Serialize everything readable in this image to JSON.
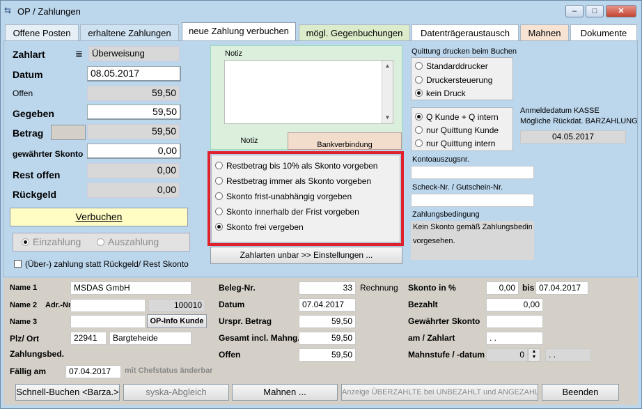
{
  "window": {
    "title": "OP / Zahlungen",
    "min": "–",
    "max": "□",
    "close": "✕"
  },
  "tabs": [
    "Offene Posten",
    "erhaltene Zahlungen",
    "neue Zahlung verbuchen",
    "mögl. Gegenbuchungen",
    "Datenträgeraustausch",
    "Mahnen",
    "Dokumente"
  ],
  "left": {
    "zahlart_label": "Zahlart",
    "zahlart_value": "Überweisung",
    "datum_label": "Datum",
    "datum_value": "08.05.2017",
    "offen_label": "Offen",
    "offen_value": "59,50",
    "gegeben_label": "Gegeben",
    "gegeben_value": "59,50",
    "betrag_label": "Betrag",
    "betrag_value": "59,50",
    "skonto_label": "gewährter Skonto",
    "skonto_value": "0,00",
    "rest_label": "Rest offen",
    "rest_value": "0,00",
    "rueckgeld_label": "Rückgeld",
    "rueckgeld_value": "0,00",
    "verbuchen": "Verbuchen",
    "einzahlung": "Einzahlung",
    "auszahlung": "Auszahlung",
    "ueberzahlung": "(Über-) zahlung statt Rückgeld/ Rest Skonto"
  },
  "notiz": {
    "label": "Notiz",
    "tab_notiz": "Notiz",
    "tab_bank": "Bankverbindung"
  },
  "skonto_options": [
    "Restbetrag bis 10% als Skonto vorgeben",
    "Restbetrag immer als Skonto vorgeben",
    "Skonto frist-unabhängig vorgeben",
    "Skonto innerhalb der Frist vorgeben",
    "Skonto frei vergeben"
  ],
  "zahlarten_button": "Zahlarten unbar >> Einstellungen ...",
  "right": {
    "quittung_title": "Quittung drucken beim Buchen",
    "drucker": [
      "Standarddrucker",
      "Druckersteuerung",
      "kein Druck"
    ],
    "quittung_opts": [
      "Q Kunde + Q intern",
      "nur Quittung Kunde",
      "nur Quittung intern"
    ],
    "anmelde1": "Anmeldedatum KASSE",
    "anmelde2": "Mögliche Rückdat. BARZAHLUNG",
    "anmelde_date": "04.05.2017",
    "konto_label": "Kontoauszugsnr.",
    "scheck_label": "Scheck-Nr. / Gutschein-Nr.",
    "zahlungsbed_label": "Zahlungsbedingung",
    "zahlungsbed_text1": "Kein Skonto gemäß Zahlungsbeding",
    "zahlungsbed_text2": "vorgesehen."
  },
  "customer": {
    "name1_label": "Name 1",
    "name1": "MSDAS GmbH",
    "name2_label": "Name 2",
    "adr_label": "Adr.-Nr.",
    "adr_value": "100010",
    "name3_label": "Name 3",
    "opinfo": "OP-Info Kunde",
    "plz_label": "Plz/ Ort",
    "plz": "22941",
    "ort": "Bargteheide",
    "zahlungsbed": "Zahlungsbed.",
    "faellig_label": "Fällig am",
    "faellig": "07.04.2017",
    "chefstatus": "mit Chefstatus änderbar"
  },
  "beleg": {
    "beleg_label": "Beleg-Nr.",
    "beleg_value": "33",
    "rechnung": "Rechnung",
    "datum_label": "Datum",
    "datum_value": "07.04.2017",
    "urspr_label": "Urspr. Betrag",
    "urspr_value": "59,50",
    "gesamt_label": "Gesamt incl. Mahng.",
    "gesamt_value": "59,50",
    "offen_label": "Offen",
    "offen_value": "59,50"
  },
  "skontoinfo": {
    "skonto_label": "Skonto in %",
    "skonto_value": "0,00",
    "bis_label": "bis",
    "bis_value": "07.04.2017",
    "bezahlt_label": "Bezahlt",
    "bezahlt_value": "0,00",
    "gew_label": "Gewährter Skonto",
    "am_label": "am / Zahlart",
    "am_value": ". .",
    "mahn_label": "Mahnstufe / -datum",
    "mahn_value": "0",
    "mahn_date": ". ."
  },
  "bottom": {
    "schnell": "Schnell-Buchen <Barza.>",
    "syska": "syska-Abgleich",
    "mahnen": "Mahnen ...",
    "anzeige": "Anzeige ÜBERZAHLTE bei UNBEZAHLT und ANGEZAHLT",
    "beenden": "Beenden"
  }
}
